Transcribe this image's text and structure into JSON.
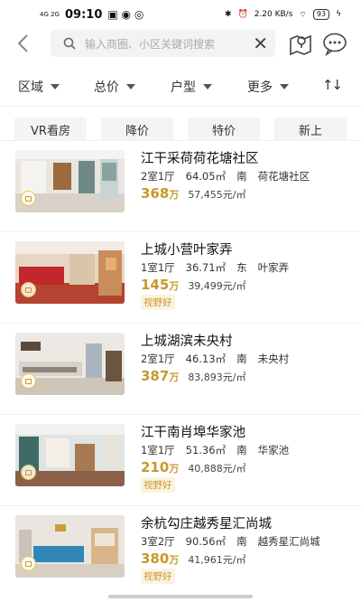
{
  "status_bar": {
    "signal_label": "4G 2G",
    "time": "09:10",
    "speed": "2.20 KB/s",
    "battery": "93"
  },
  "search": {
    "placeholder": "输入商圈、小区关键词搜索"
  },
  "filters": [
    {
      "label": "区域"
    },
    {
      "label": "总价"
    },
    {
      "label": "户型"
    },
    {
      "label": "更多"
    }
  ],
  "sort_label": "↑↓",
  "tags": [
    "VR看房",
    "降价",
    "特价",
    "新上"
  ],
  "listings": [
    {
      "title": "江干采荷荷花塘社区",
      "layout": "2室1厅",
      "area": "64.05㎡",
      "orientation": "南",
      "community": "荷花塘社区",
      "price": "368",
      "price_unit": "万",
      "unit_price": "57,455元/㎡",
      "badge": ""
    },
    {
      "title": "上城小营叶家弄",
      "layout": "1室1厅",
      "area": "36.71㎡",
      "orientation": "东",
      "community": "叶家弄",
      "price": "145",
      "price_unit": "万",
      "unit_price": "39,499元/㎡",
      "badge": "视野好"
    },
    {
      "title": "上城湖滨未央村",
      "layout": "2室1厅",
      "area": "46.13㎡",
      "orientation": "南",
      "community": "未央村",
      "price": "387",
      "price_unit": "万",
      "unit_price": "83,893元/㎡",
      "badge": ""
    },
    {
      "title": "江干南肖埠华家池",
      "layout": "1室1厅",
      "area": "51.36㎡",
      "orientation": "南",
      "community": "华家池",
      "price": "210",
      "price_unit": "万",
      "unit_price": "40,888元/㎡",
      "badge": "视野好"
    },
    {
      "title": "余杭勾庄越秀星汇尚城",
      "layout": "3室2厅",
      "area": "90.56㎡",
      "orientation": "南",
      "community": "越秀星汇尚城",
      "price": "380",
      "price_unit": "万",
      "unit_price": "41,961元/㎡",
      "badge": "视野好"
    }
  ],
  "colors": {
    "accent_gold": "#c8982c",
    "tag_bg": "#f4f4f4"
  }
}
